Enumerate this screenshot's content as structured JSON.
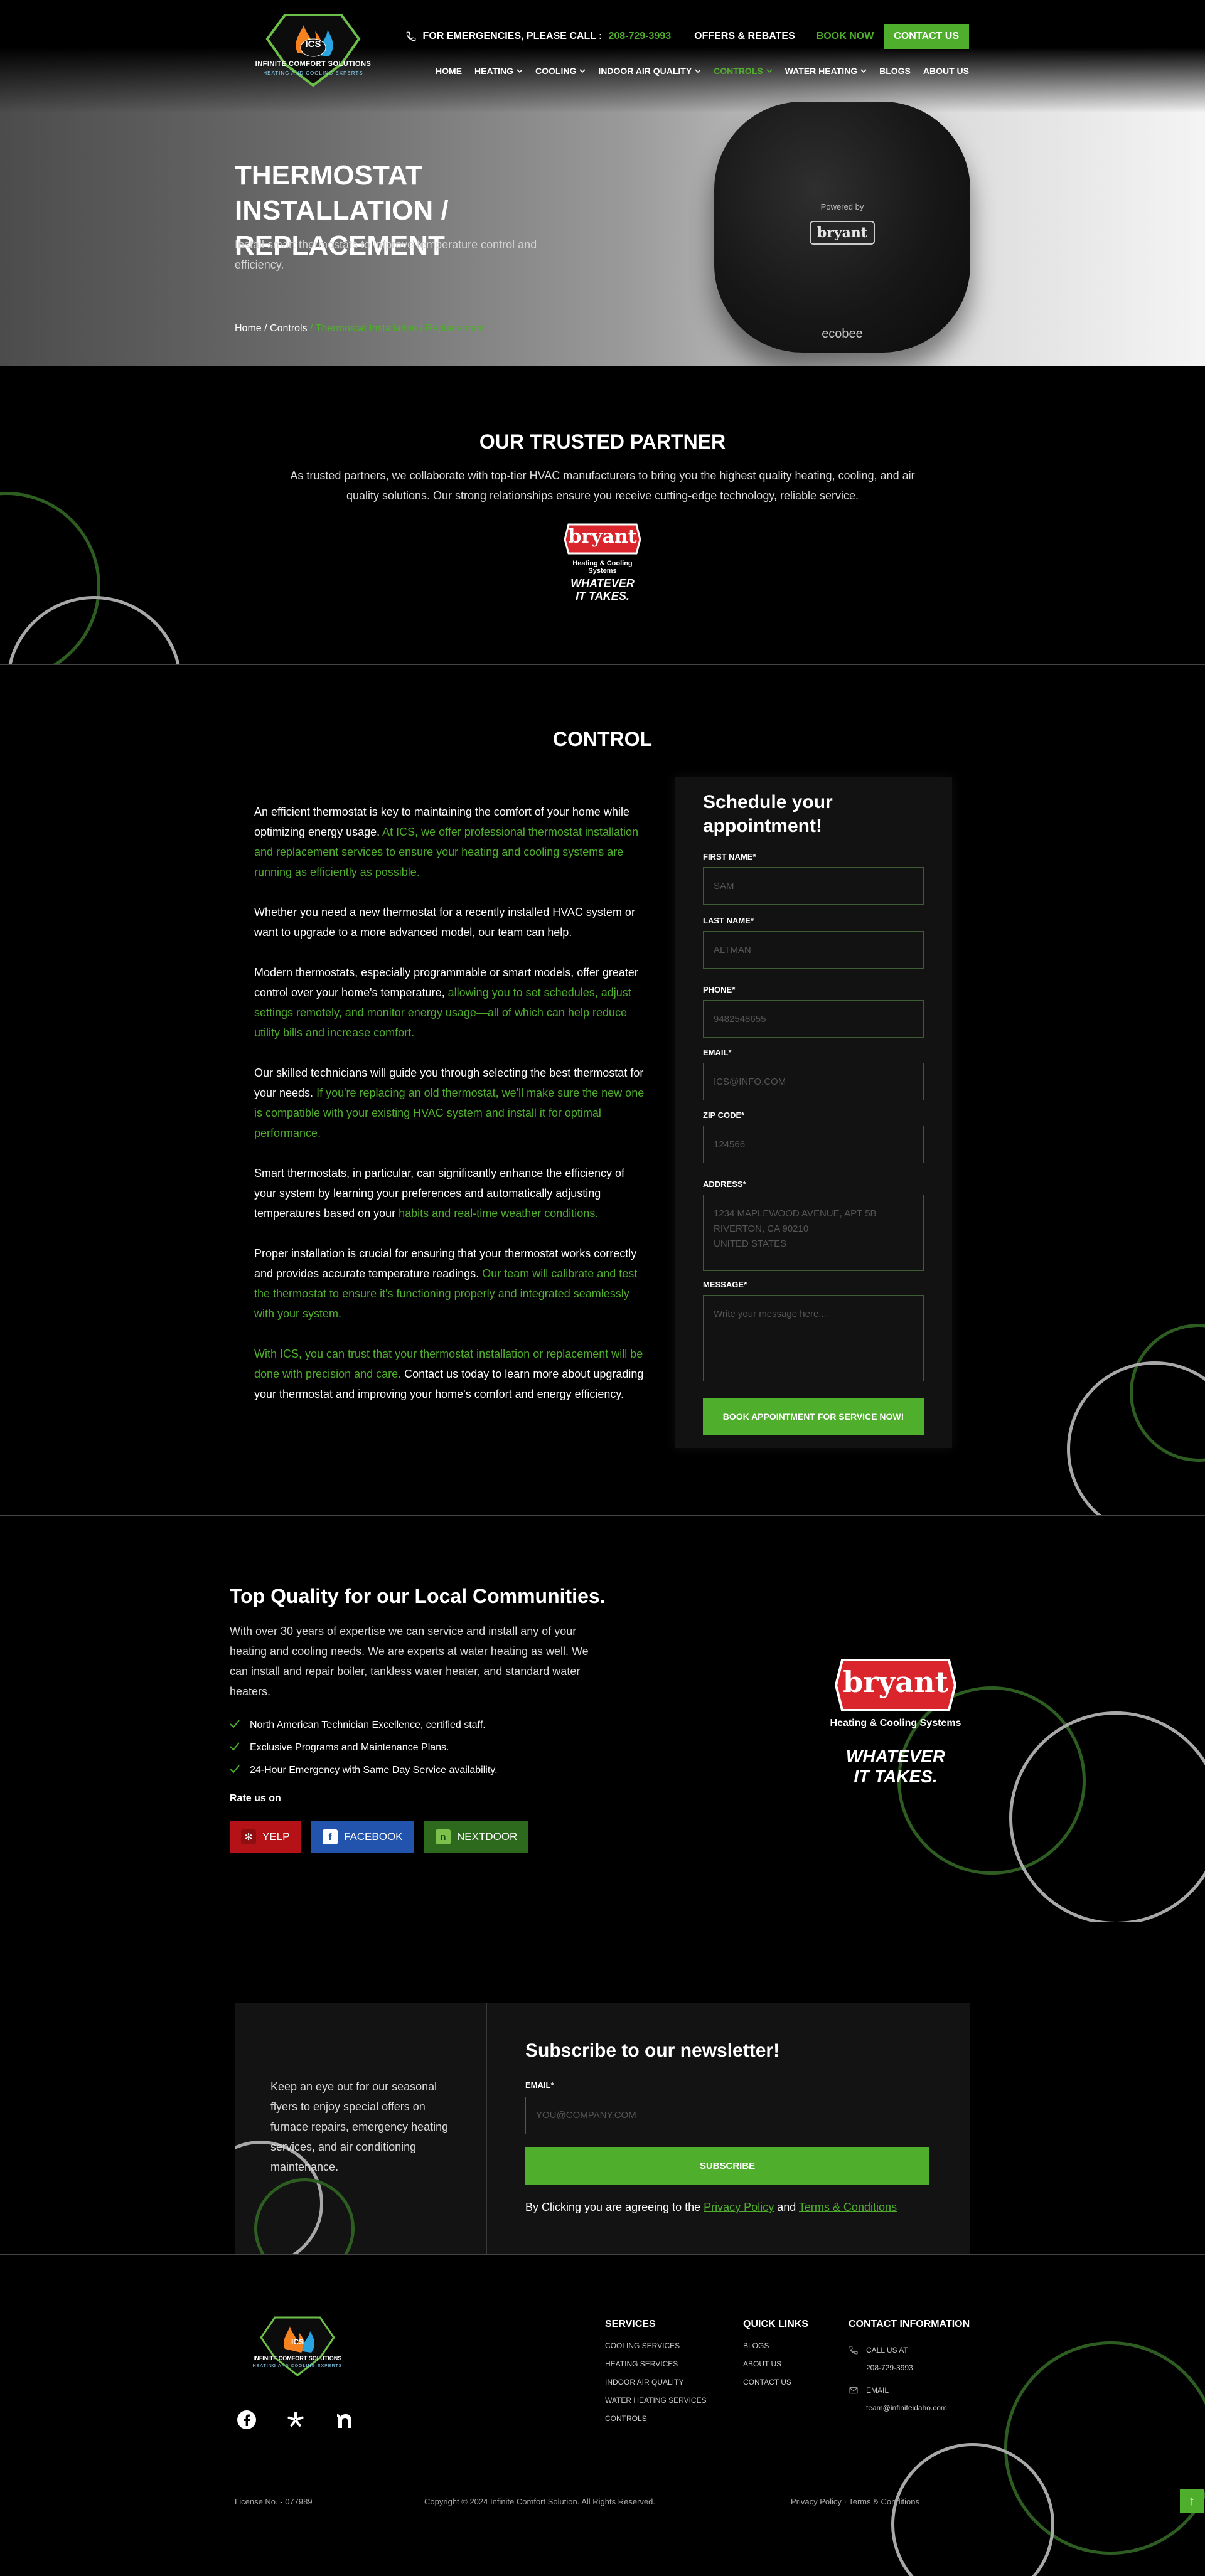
{
  "brand": {
    "initials": "ICS",
    "name": "INFINITE COMFORT SOLUTIONS",
    "tagline": "HEATING AND COOLING EXPERTS"
  },
  "topbar": {
    "emergency_text": "FOR EMERGENCIES, PLEASE CALL :",
    "phone": "208-729-3993",
    "offers": "OFFERS & REBATES",
    "book": "BOOK NOW",
    "contact": "CONTACT US"
  },
  "nav": [
    {
      "label": "HOME",
      "dropdown": false,
      "active": false
    },
    {
      "label": "HEATING",
      "dropdown": true,
      "active": false
    },
    {
      "label": "COOLING",
      "dropdown": true,
      "active": false
    },
    {
      "label": "INDOOR AIR QUALITY",
      "dropdown": true,
      "active": false
    },
    {
      "label": "CONTROLS",
      "dropdown": true,
      "active": true
    },
    {
      "label": "WATER HEATING",
      "dropdown": true,
      "active": false
    },
    {
      "label": "BLOGS",
      "dropdown": false,
      "active": false
    },
    {
      "label": "ABOUT US",
      "dropdown": false,
      "active": false
    }
  ],
  "hero": {
    "title": "THERMOSTAT INSTALLATION / REPLACEMENT",
    "subtitle": "Install smart thermostats to improve temperature control and efficiency.",
    "breadcrumb": {
      "home": "Home",
      "sep": " / ",
      "parent": "Controls",
      "current": " / Thermostat Installation / Replacement"
    },
    "device": {
      "powered_by": "Powered by",
      "brand": "bryant",
      "model": "ecobee"
    }
  },
  "partner": {
    "title": "OUR TRUSTED PARTNER",
    "text": "As trusted partners, we collaborate with top-tier HVAC manufacturers to bring you the highest quality heating, cooling, and air quality solutions. Our strong relationships ensure you receive cutting-edge technology, reliable service.",
    "logo": {
      "name": "bryant",
      "line": "Heating & Cooling Systems",
      "slogan1": "WHATEVER",
      "slogan2": "IT TAKES."
    }
  },
  "control": {
    "title": "CONTROL",
    "paragraphs": [
      {
        "plain": "An efficient thermostat is key to maintaining the comfort of your home while optimizing energy usage. ",
        "highlight": "At ICS, we offer professional thermostat installation and replacement services to ensure your heating and cooling systems are running as efficiently as possible.",
        "after": ""
      },
      {
        "plain": "Whether you need a new thermostat for a recently installed HVAC system or want to upgrade to a more advanced model, our team can help.",
        "highlight": "",
        "after": ""
      },
      {
        "plain": "Modern thermostats, especially programmable or smart models, offer greater control over your home's temperature, ",
        "highlight": "allowing you to set schedules, adjust settings remotely, and monitor energy usage—all of which can help reduce utility bills and increase comfort.",
        "after": ""
      },
      {
        "plain": "Our skilled technicians will guide you through selecting the best thermostat for your needs. ",
        "highlight": "If you're replacing an old thermostat, we'll make sure the new one is compatible with your existing HVAC system and install it for optimal performance.",
        "after": ""
      },
      {
        "plain": "Smart thermostats, in particular, can significantly enhance the efficiency of your system by learning your preferences and automatically adjusting temperatures based on your ",
        "highlight": "habits and real-time weather conditions.",
        "after": ""
      },
      {
        "plain": "Proper installation is crucial for ensuring that your thermostat works correctly and provides accurate temperature readings. ",
        "highlight": "Our team will calibrate and test the thermostat to ensure it's functioning properly and integrated seamlessly with your system.",
        "after": ""
      },
      {
        "plain": "",
        "highlight": "With ICS, you can trust that your thermostat installation or replacement will be done with precision and care.",
        "after": " Contact us today to learn more about upgrading your thermostat and improving your home's comfort and energy efficiency."
      }
    ]
  },
  "form": {
    "title": "Schedule your appointment!",
    "first_name": {
      "label": "FIRST NAME*",
      "placeholder": "SAM"
    },
    "last_name": {
      "label": "LAST NAME*",
      "placeholder": "ALTMAN"
    },
    "phone": {
      "label": "PHONE*",
      "placeholder": "9482548655"
    },
    "email": {
      "label": "EMAIL*",
      "placeholder": "ICS@INFO.COM"
    },
    "zip": {
      "label": "ZIP CODE*",
      "placeholder": "124566"
    },
    "address": {
      "label": "ADDRESS*",
      "placeholder": "1234 MAPLEWOOD AVENUE, APT 5B\nRIVERTON, CA 90210\nUNITED STATES"
    },
    "message": {
      "label": "MESSAGE*",
      "placeholder": "Write your message here..."
    },
    "submit": "BOOK APPOINTMENT FOR SERVICE NOW!"
  },
  "quality": {
    "title": "Top Quality for our Local Communities.",
    "description": "With over 30 years of expertise we can service and install any of your heating and cooling needs. We are experts at water heating as well. We can install and repair boiler, tankless water heater, and standard water heaters.",
    "features": [
      "North American Technician Excellence, certified staff.",
      "Exclusive Programs and Maintenance Plans.",
      "24-Hour Emergency with Same Day Service availability."
    ],
    "rate_label": "Rate us on",
    "rate_buttons": [
      {
        "label": "YELP",
        "color": "#b51217"
      },
      {
        "label": "FACEBOOK",
        "color": "#2253ad"
      },
      {
        "label": "NEXTDOOR",
        "color": "#2e6a1e"
      }
    ]
  },
  "newsletter": {
    "promo": "Keep an eye out for our seasonal flyers to enjoy special offers on furnace repairs, emergency heating services, and air conditioning maintenance.",
    "title": "Subscribe to our newsletter!",
    "email_label": "EMAIL*",
    "email_placeholder": "YOU@COMPANY.COM",
    "subscribe": "SUBSCRIBE",
    "agree_prefix": "By Clicking you are agreeing to the ",
    "privacy": "Privacy Policy",
    "and": " and ",
    "terms": "Terms & Conditions"
  },
  "footer": {
    "services_title": "SERVICES",
    "services": [
      "COOLING SERVICES",
      "HEATING SERVICES",
      "INDOOR AIR QUALITY",
      "WATER HEATING SERVICES",
      "CONTROLS"
    ],
    "quick_title": "QUICK LINKS",
    "quick": [
      "BLOGS",
      "ABOUT US",
      "CONTACT US"
    ],
    "contact_title": "CONTACT INFORMATION",
    "call_label": "CALL US AT",
    "call_value": "208-729-3993",
    "email_label": "EMAIL",
    "email_value": "team@infiniteidaho.com",
    "license": "License No. - 077989",
    "copyright": "Copyright © 2024 Infinite Comfort Solution. All Rights Reserved.",
    "privacy": "Privacy Policy",
    "policy_sep": " · ",
    "terms": "Terms & Conditions"
  },
  "colors": {
    "accent": "#4fae2c",
    "bryant_red": "#d9252b"
  }
}
